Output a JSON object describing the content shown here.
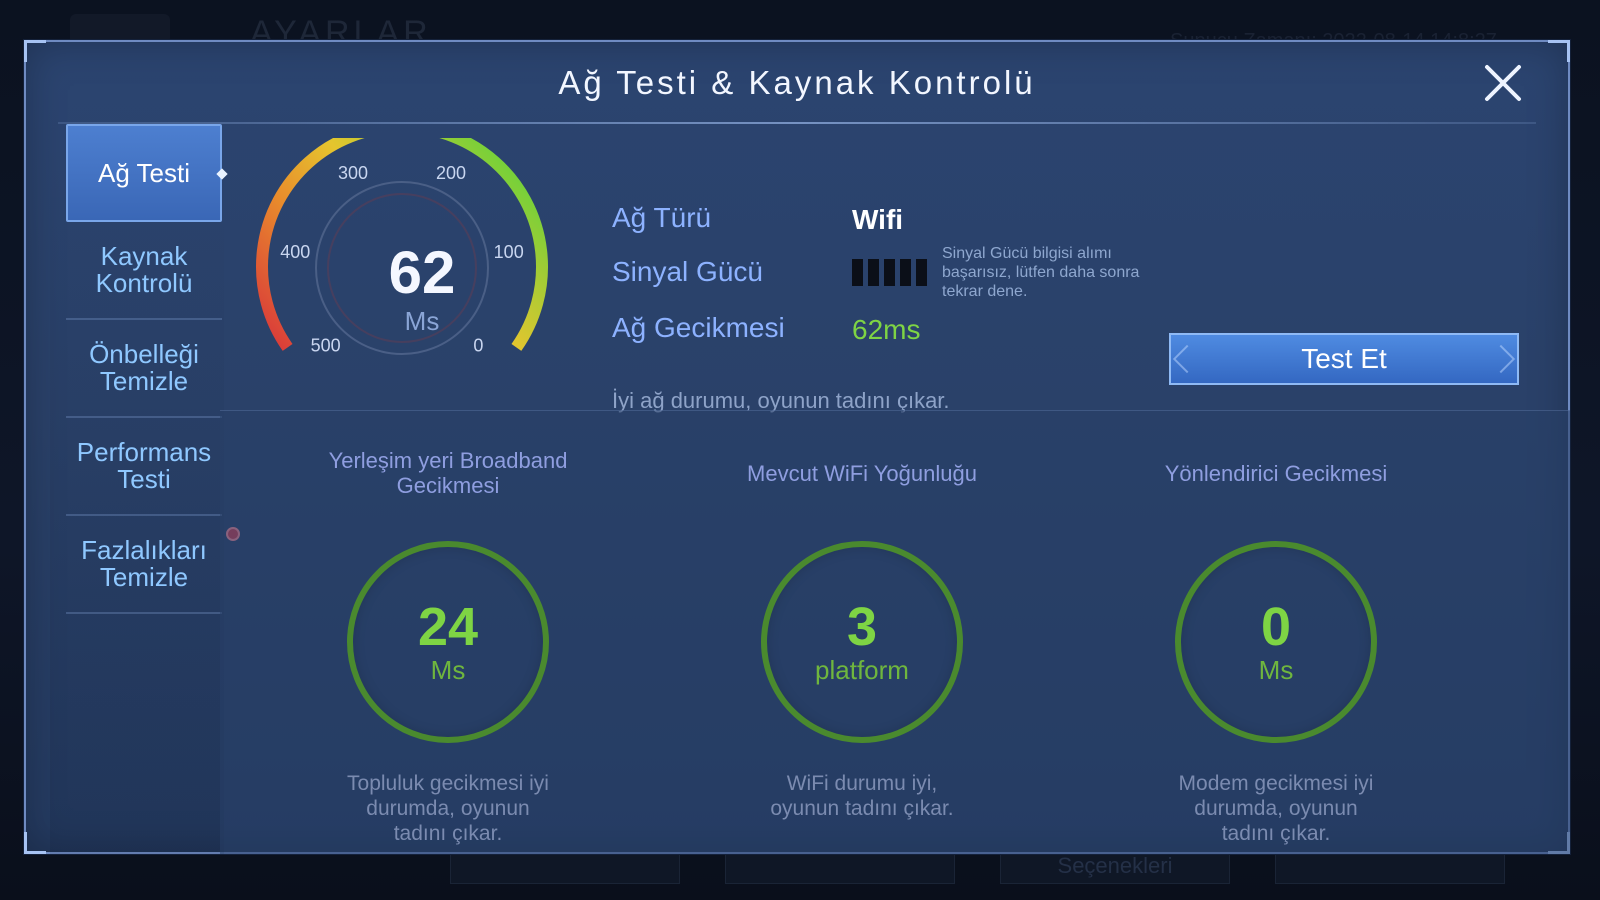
{
  "background": {
    "title": "AYARLAR",
    "server_time": "Sunucu Zamanı: 2022-08-14 14:8:27",
    "bottom_buttons": [
      "",
      "",
      "Seçenekleri",
      ""
    ]
  },
  "dialog": {
    "title": "Ağ Testi & Kaynak Kontrolü",
    "close": "close"
  },
  "sidebar": {
    "items": [
      {
        "label": "Ağ Testi",
        "active": true
      },
      {
        "label": "Kaynak Kontrolü",
        "active": false
      },
      {
        "label": "Önbelleği Temizle",
        "active": false
      },
      {
        "label": "Performans Testi",
        "active": false
      },
      {
        "label": "Fazlalıkları Temizle",
        "active": false
      }
    ]
  },
  "gauge": {
    "value": "62",
    "unit": "Ms",
    "ticks": [
      "500",
      "400",
      "300",
      "200",
      "100",
      "0"
    ],
    "max": 500,
    "current": 62
  },
  "network": {
    "type_label": "Ağ Türü",
    "type_value": "Wifi",
    "signal_label": "Sinyal Gücü",
    "signal_note": "Sinyal Gücü bilgisi alımı başarısız, lütfen daha sonra tekrar dene.",
    "latency_label": "Ağ Gecikmesi",
    "latency_value": "62ms",
    "status_text": "İyi ağ durumu, oyunun tadını çıkar.",
    "test_button": "Test Et"
  },
  "metrics": [
    {
      "title": "Yerleşim yeri Broadband Gecikmesi",
      "value": "24",
      "unit": "Ms",
      "desc": "Topluluk gecikmesi iyi durumda, oyunun tadını çıkar."
    },
    {
      "title": "Mevcut WiFi Yoğunluğu",
      "value": "3",
      "unit": "platform",
      "desc": "WiFi durumu iyi, oyunun tadını çıkar."
    },
    {
      "title": "Yönlendirici Gecikmesi",
      "value": "0",
      "unit": "Ms",
      "desc": "Modem gecikmesi iyi durumda, oyunun tadını çıkar."
    }
  ],
  "colors": {
    "accent_green": "#7ed444",
    "panel_blue": "#2b4470",
    "active_tab": "#4d7fd0",
    "label_blue": "#8db2ff"
  }
}
